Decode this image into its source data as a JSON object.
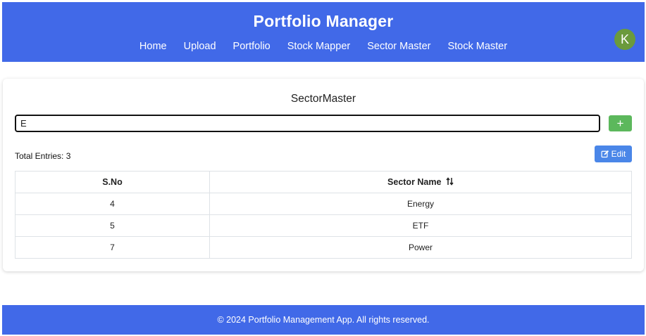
{
  "header": {
    "title": "Portfolio Manager",
    "nav": [
      "Home",
      "Upload",
      "Portfolio",
      "Stock Mapper",
      "Sector Master",
      "Stock Master"
    ],
    "avatar_letter": "K"
  },
  "card": {
    "title": "SectorMaster",
    "search_value": "E",
    "add_label": "+",
    "total_entries_label": "Total Entries: 3",
    "edit_label": "Edit",
    "table": {
      "headers": [
        "S.No",
        "Sector Name"
      ],
      "rows": [
        [
          "4",
          "Energy"
        ],
        [
          "5",
          "ETF"
        ],
        [
          "7",
          "Power"
        ]
      ]
    }
  },
  "footer": {
    "text": "© 2024 Portfolio Management App. All rights reserved."
  },
  "colors": {
    "header_bg": "#4169e8",
    "add_button": "#5cb85c",
    "edit_button": "#4a86e8",
    "avatar_bg": "#6b9a3c"
  }
}
